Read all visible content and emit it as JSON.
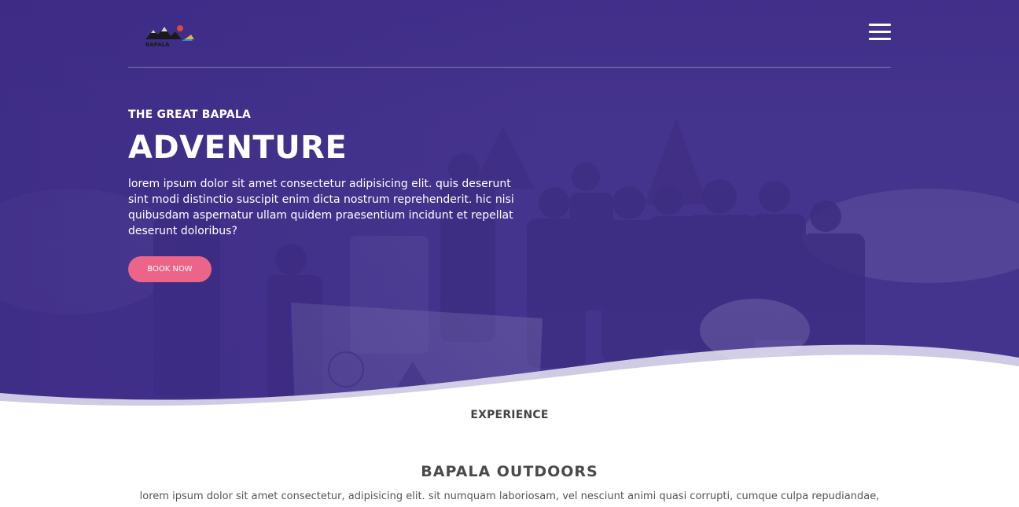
{
  "brand": {
    "logo_text": "BAPALA",
    "logo_icon": "mountain-logo-icon"
  },
  "header": {
    "menu_icon": "hamburger-menu-icon"
  },
  "hero": {
    "eyebrow": "THE GREAT BAPALA",
    "title": "ADVENTURE",
    "description": "lorem ipsum dolor sit amet consectetur adipisicing elit. quis deserunt sint modi distinctio suscipit enim dicta nostrum reprehenderit. hic nisi quibusdam aspernatur ullam quidem praesentium incidunt et repellat deserunt doloribus?",
    "cta_label": "BOOK NOW"
  },
  "section": {
    "eyebrow": "EXPERIENCE",
    "title": "BAPALA OUTDOORS",
    "text": "lorem ipsum dolor sit amet consectetur, adipisicing elit. sit numquam laboriosam, vel nesciunt animi quasi corrupti, cumque culpa repudiandae,"
  },
  "colors": {
    "hero_purple": "#45358f",
    "cta_pink": "#ec6589"
  }
}
